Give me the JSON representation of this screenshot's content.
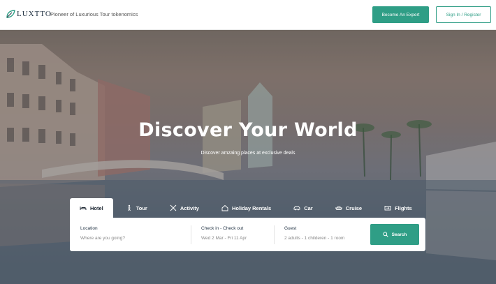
{
  "header": {
    "logo_text": "LUXTTO",
    "tagline": "Pioneer of Luxurious Tour tokenomics",
    "become_expert_label": "Become An Expert",
    "sign_in_label": "Sign In / Register"
  },
  "hero": {
    "title": "Discover Your World",
    "subtitle": "Discover amzaing places at exclusive deals"
  },
  "tabs": [
    {
      "label": "Hotel",
      "icon": "bed-icon",
      "active": true
    },
    {
      "label": "Tour",
      "icon": "hiker-icon",
      "active": false
    },
    {
      "label": "Activity",
      "icon": "ski-icon",
      "active": false
    },
    {
      "label": "Holiday Rentals",
      "icon": "house-icon",
      "active": false
    },
    {
      "label": "Car",
      "icon": "car-icon",
      "active": false
    },
    {
      "label": "Cruise",
      "icon": "ship-icon",
      "active": false
    },
    {
      "label": "Flights",
      "icon": "airplane-ticket-icon",
      "active": false
    }
  ],
  "search": {
    "location_label": "Location",
    "location_placeholder": "Where are you going?",
    "dates_label": "Check in - Check out",
    "dates_value": "Wed 2 Mar - Fri 11 Apr",
    "guest_label": "Guest",
    "guest_value": "2 adults - 1 childeren - 1 room",
    "search_label": "Search"
  },
  "colors": {
    "accent": "#2f9e86",
    "text_dark": "#1b2530"
  }
}
